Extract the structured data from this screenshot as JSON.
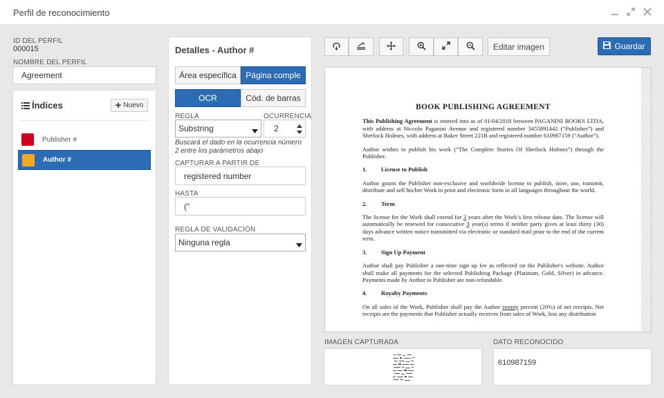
{
  "window": {
    "title": "Perfil de reconocimiento"
  },
  "profile": {
    "id_label": "ID DEL PERFIL",
    "id_value": "000015",
    "name_label": "NOMBRE DEL PERFIL",
    "name_value": "Agreement"
  },
  "indices": {
    "title": "Índices",
    "new_label": "Nuevo",
    "items": [
      {
        "label": "Publisher #",
        "color": "#d0021b",
        "selected": false
      },
      {
        "label": "Author #",
        "color": "#f5a623",
        "selected": true
      }
    ]
  },
  "details": {
    "title": "Detalles - Author #",
    "area_tabs": [
      "Área específica",
      "Página comple"
    ],
    "mode_tabs": [
      "OCR",
      "Cód. de barras"
    ],
    "rule_label": "REGLA",
    "rule_value": "Substring",
    "occurrence_label": "OCURRENCIA",
    "occurrence_value": "2",
    "hint": "Buscará el dado en la ocurrencia número 2 entre los parámetros abajo",
    "capture_from_label": "CAPTURAR A PARTIR DE",
    "capture_from_value": "registered number",
    "until_label": "HASTA",
    "until_value": "(\"",
    "validation_label": "REGLA DE VALIDACIÓN",
    "validation_value": "Ninguna regla"
  },
  "toolbar": {
    "edit_image": "Editar imagen",
    "save": "Guardar",
    "icons": [
      "rotate-icon",
      "flip-icon",
      "move-icon",
      "zoom-in-icon",
      "expand-icon",
      "zoom-out-icon"
    ]
  },
  "document": {
    "title": "BOOK PUBLISHING AGREEMENT",
    "p1_bold": "This Publishing Agreement",
    "p1_rest": " is entered into as of 01/04/2018 between PAGANINI BOOKS LTDA, with address at Niccolo Paganini Avenue and registered number 3455891442 (“Publisher”) and Sherlock Holmes, with address at Baker Street 221B and registered number 610987159 (“Author”).",
    "p2": "Author wishes to publish his work (“The Complete Stories Of Sherlock Holmes”) through the Publisher.",
    "s1_num": "1.",
    "s1_title": "License to Publish",
    "s1_body": "Author grants the Publisher non-exclusive and worldwide license to publish, store, use, transmit, distribute and sell his/her Work in print and electronic form in all languages throughout the world.",
    "s2_num": "2.",
    "s2_title": "Term",
    "s2_body_a": "The license for the Work shall extend for ",
    "s2_body_u1": "3",
    "s2_body_b": " years after the Work’s first release date. The license will automatically be renewed for consecutive ",
    "s2_body_u2": "3",
    "s2_body_c": " year(s) terms if neither party gives at least thirty (30) days advance written notice transmitted via electronic or standard mail prior to the end of the current term.",
    "s3_num": "3.",
    "s3_title": "Sign Up Payment",
    "s3_body": "Author shall pay Publisher a one-time sign up fee as reflected on the Publisher's website. Author shall make all payments for the selected Publishing Package (Platinum, Gold, Silver) in advance. Payments made by Author to Publisher are non-refundable.",
    "s4_num": "4.",
    "s4_title": "Royalty Payments",
    "s4_body_a": "On all sales of the Work, Publisher shall pay the Author ",
    "s4_body_u": "twenty",
    "s4_body_b": " percent (20%) of net receipts. Net receipts are the payments that Publisher actually receives from sales of Work, less any distribution"
  },
  "captured": {
    "image_label": "IMAGEN CAPTURADA",
    "data_label": "DATO RECONOCIDO",
    "data_value": "610987159"
  }
}
